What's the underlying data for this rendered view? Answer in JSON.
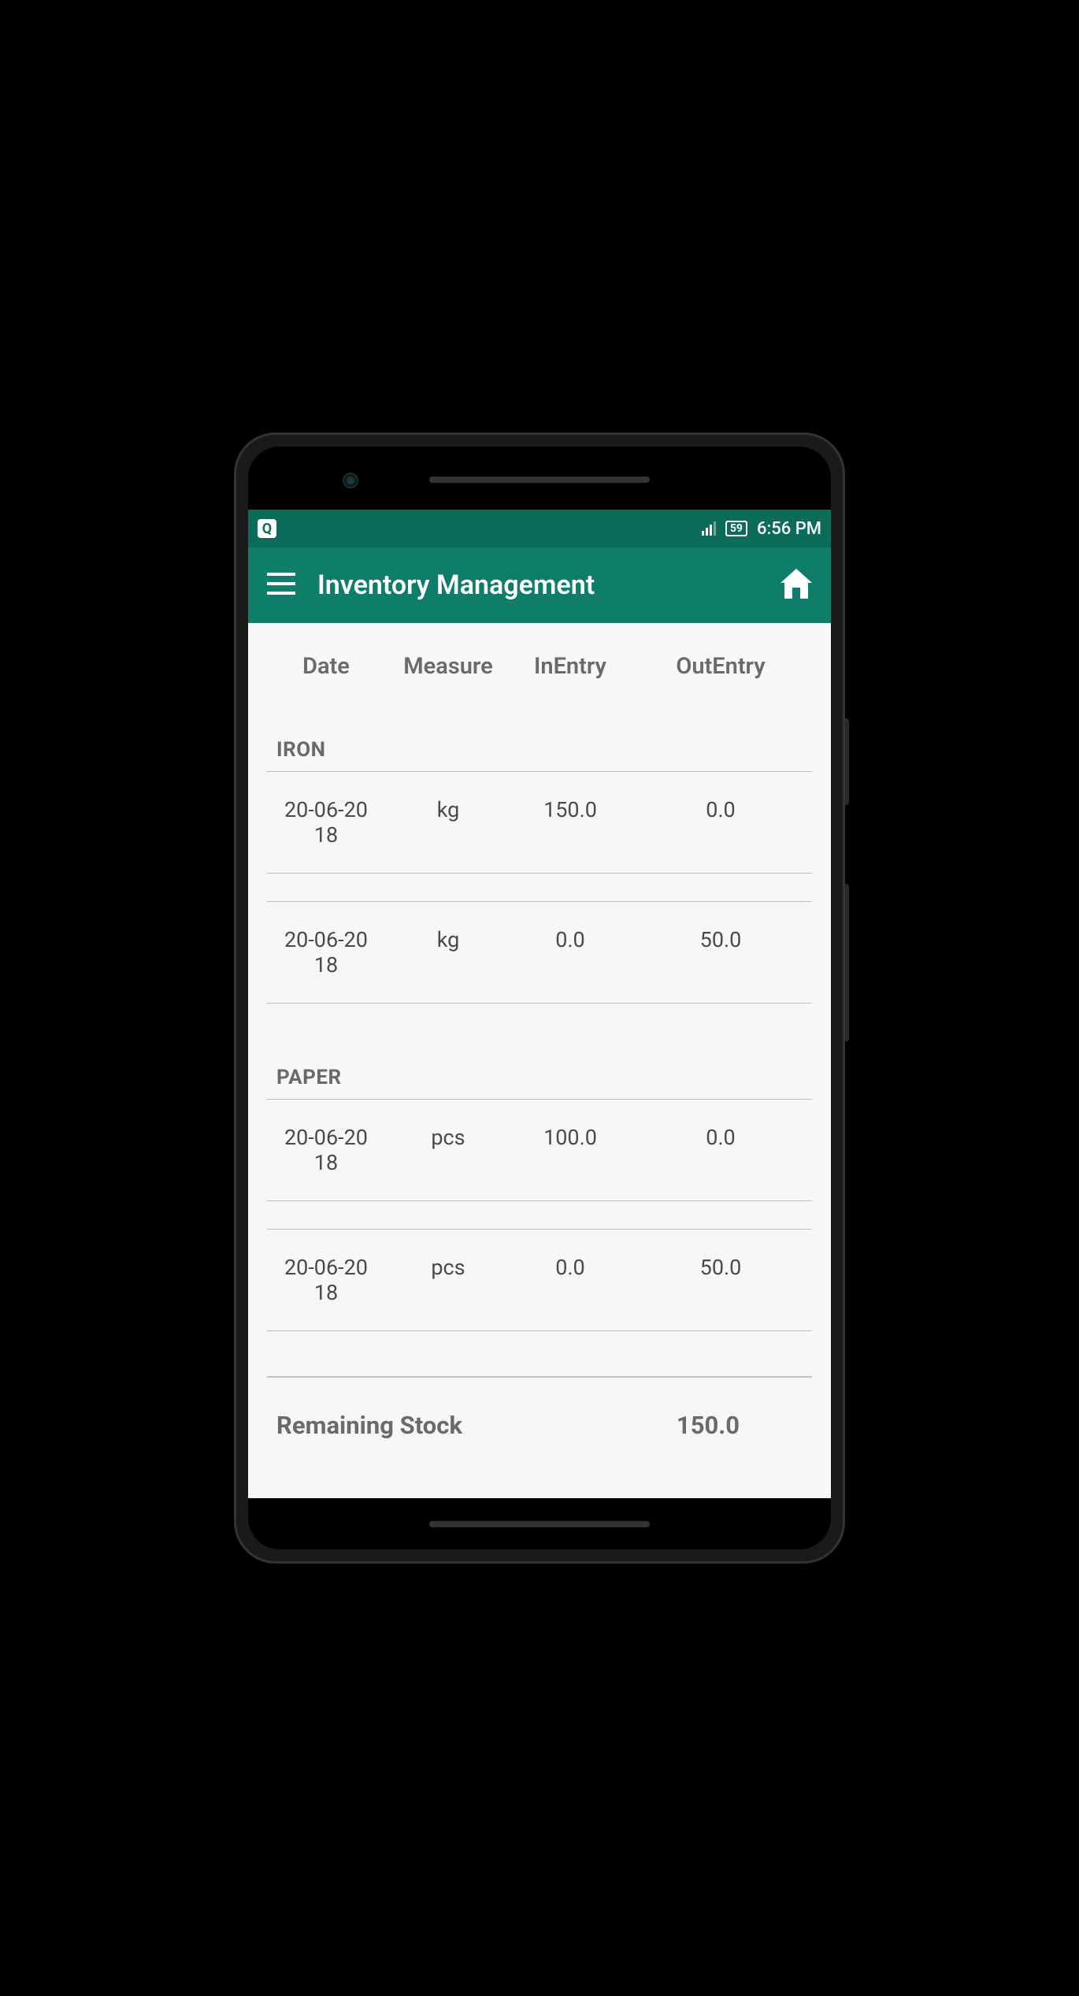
{
  "statusBar": {
    "qIcon": "Q",
    "battery": "59",
    "time": "6:56 PM"
  },
  "appBar": {
    "title": "Inventory Management"
  },
  "table": {
    "headers": {
      "date": "Date",
      "measure": "Measure",
      "inEntry": "InEntry",
      "outEntry": "OutEntry"
    },
    "groups": [
      {
        "name": "IRON",
        "rows": [
          {
            "date": "20-06-2018",
            "measure": "kg",
            "in": "150.0",
            "out": "0.0"
          },
          {
            "date": "20-06-2018",
            "measure": "kg",
            "in": "0.0",
            "out": "50.0"
          }
        ]
      },
      {
        "name": "PAPER",
        "rows": [
          {
            "date": "20-06-2018",
            "measure": "pcs",
            "in": "100.0",
            "out": "0.0"
          },
          {
            "date": "20-06-2018",
            "measure": "pcs",
            "in": "0.0",
            "out": "50.0"
          }
        ]
      }
    ],
    "remaining": {
      "label": "Remaining Stock",
      "value": "150.0"
    }
  }
}
